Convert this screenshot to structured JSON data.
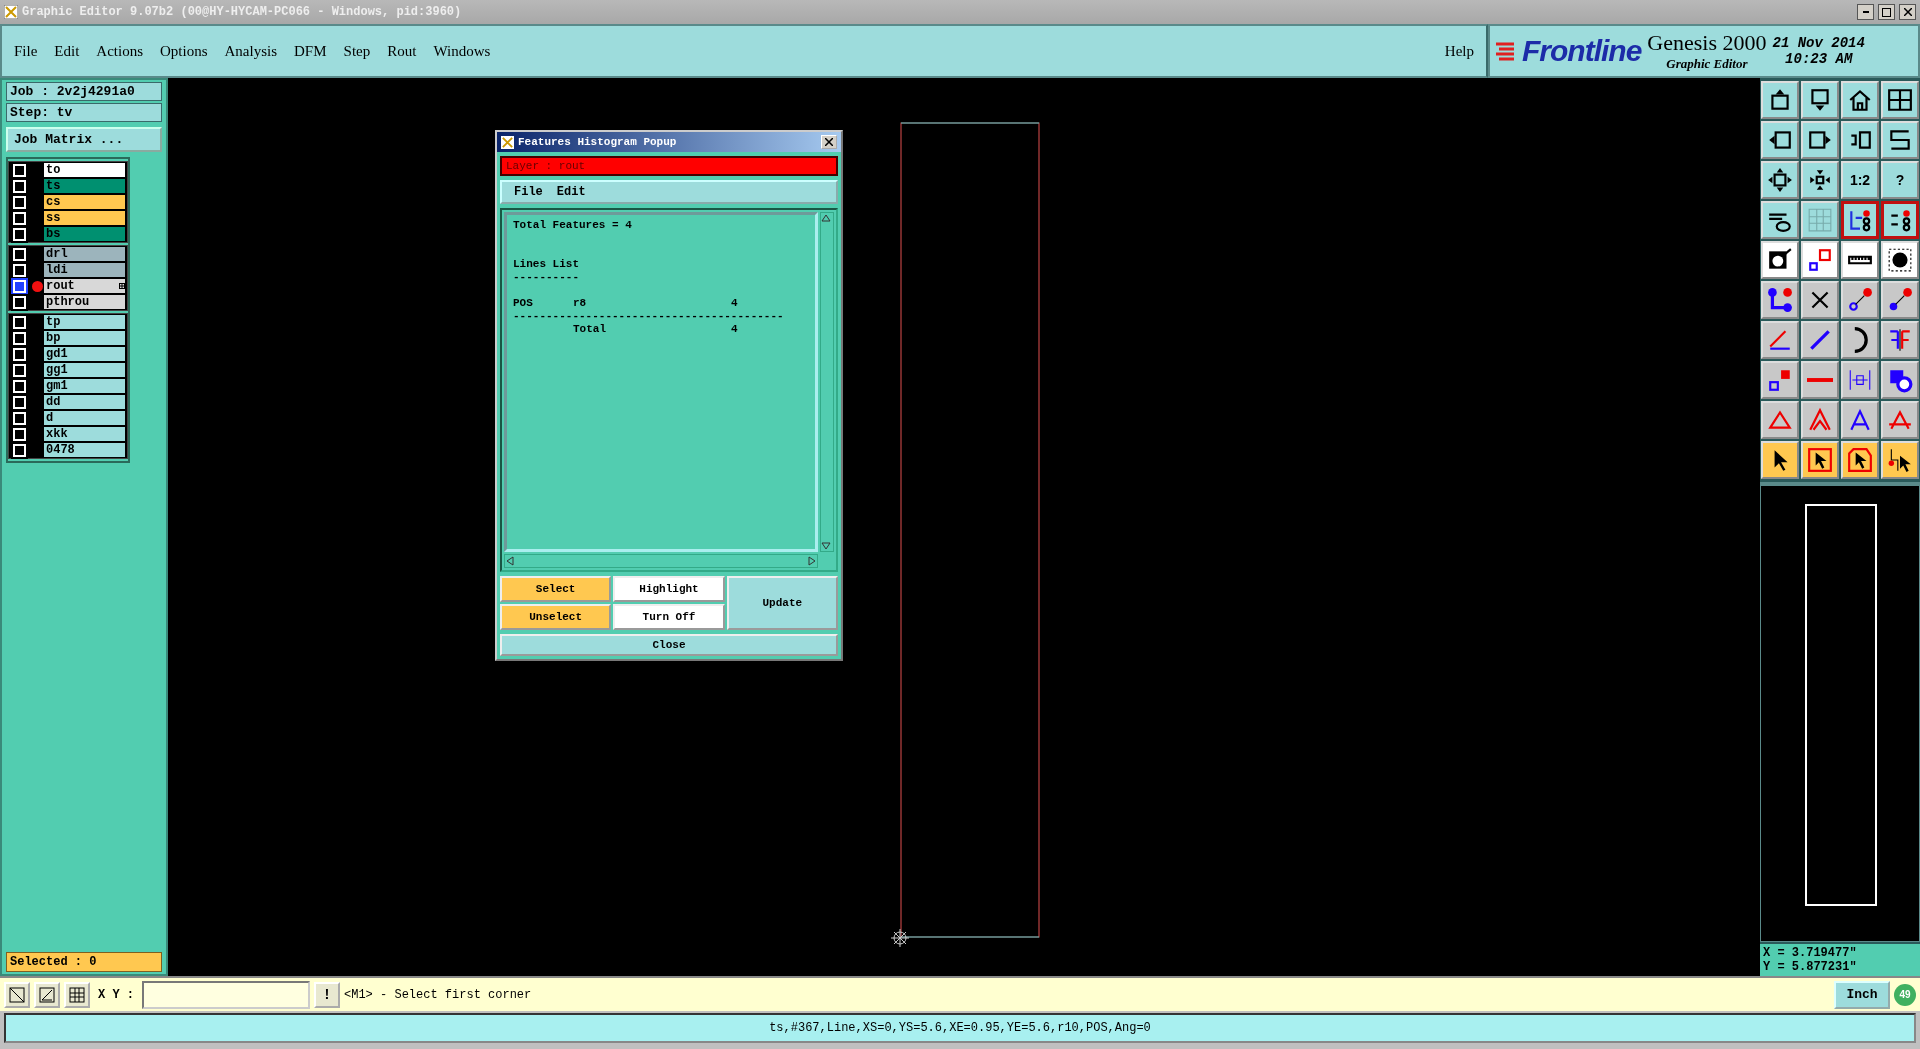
{
  "window": {
    "title": "Graphic Editor 9.07b2 (00@HY-HYCAM-PC066 - Windows, pid:3960)"
  },
  "menu": [
    "File",
    "Edit",
    "Actions",
    "Options",
    "Analysis",
    "DFM",
    "Step",
    "Rout",
    "Windows"
  ],
  "help": "Help",
  "brand": {
    "logo": "Frontline",
    "product": "Genesis 2000",
    "subtitle": "Graphic Editor",
    "date": "21 Nov 2014",
    "time": "10:23 AM"
  },
  "job": {
    "job": "Job : 2v2j4291a0",
    "step": "Step: tv",
    "matrix_button": "Job Matrix ..."
  },
  "layer_groups": [
    [
      {
        "name": "to",
        "color": "#ffffff",
        "selected": false
      },
      {
        "name": "ts",
        "color": "#009070",
        "selected": false
      },
      {
        "name": "cs",
        "color": "#ffc850",
        "selected": false
      },
      {
        "name": "ss",
        "color": "#ffc850",
        "selected": false
      },
      {
        "name": "bs",
        "color": "#009070",
        "selected": false
      }
    ],
    [
      {
        "name": "drl",
        "color": "#9cb4bc",
        "selected": false
      },
      {
        "name": "ldi",
        "color": "#9cb4bc",
        "selected": false
      },
      {
        "name": "rout",
        "color": "#d8d8d8",
        "selected": true
      },
      {
        "name": "pthrou",
        "color": "#d8d8d8",
        "selected": false
      }
    ],
    [
      {
        "name": "tp",
        "color": "#9ddcdc",
        "selected": false
      },
      {
        "name": "bp",
        "color": "#9ddcdc",
        "selected": false
      },
      {
        "name": "gd1",
        "color": "#9ddcdc",
        "selected": false
      },
      {
        "name": "gg1",
        "color": "#9ddcdc",
        "selected": false
      },
      {
        "name": "gm1",
        "color": "#9ddcdc",
        "selected": false
      },
      {
        "name": "dd",
        "color": "#9ddcdc",
        "selected": false
      },
      {
        "name": "d",
        "color": "#9ddcdc",
        "selected": false
      },
      {
        "name": "xkk",
        "color": "#9ddcdc",
        "selected": false
      },
      {
        "name": "0478",
        "color": "#9ddcdc",
        "selected": false
      }
    ]
  ],
  "selected_count": "Selected : 0",
  "popup": {
    "title": "Features Histogram Popup",
    "layer": "Layer :  rout",
    "menu": [
      "File",
      "Edit"
    ],
    "total": "Total Features = 4",
    "section": "Lines List",
    "underline": "----------",
    "rows": [
      {
        "polarity": "POS",
        "symbol": "r8",
        "count": "4"
      }
    ],
    "separator": "-----------------------------------------",
    "sum": {
      "label": "Total",
      "count": "4"
    },
    "buttons": [
      {
        "label": "Select",
        "kind": "orange"
      },
      {
        "label": "Highlight",
        "kind": "white"
      },
      {
        "label": "Update",
        "kind": "cyan"
      },
      {
        "label": "Unselect",
        "kind": "orange"
      },
      {
        "label": "Turn Off",
        "kind": "white"
      }
    ],
    "close": "Close"
  },
  "toolbar": [
    {
      "kind": "cyan"
    },
    {
      "kind": "cyan"
    },
    {
      "kind": "cyan"
    },
    {
      "kind": "cyan"
    },
    {
      "kind": "cyan"
    },
    {
      "kind": "cyan"
    },
    {
      "kind": "cyan"
    },
    {
      "kind": "cyan"
    },
    {
      "kind": "cyan"
    },
    {
      "kind": "cyan"
    },
    {
      "kind": "cyan",
      "label": "1:2"
    },
    {
      "kind": "cyan",
      "label": "?"
    },
    {
      "kind": "cyan"
    },
    {
      "kind": "cyan"
    },
    {
      "kind": "framed"
    },
    {
      "kind": "framed"
    },
    {
      "kind": "white"
    },
    {
      "kind": "white"
    },
    {
      "kind": "white"
    },
    {
      "kind": "white"
    },
    {
      "kind": "grey"
    },
    {
      "kind": "grey"
    },
    {
      "kind": "grey"
    },
    {
      "kind": "grey"
    },
    {
      "kind": "grey"
    },
    {
      "kind": "grey"
    },
    {
      "kind": "grey"
    },
    {
      "kind": "grey"
    },
    {
      "kind": "grey"
    },
    {
      "kind": "grey"
    },
    {
      "kind": "grey"
    },
    {
      "kind": "grey"
    },
    {
      "kind": "grey"
    },
    {
      "kind": "grey"
    },
    {
      "kind": "grey"
    },
    {
      "kind": "grey"
    },
    {
      "kind": "orange"
    },
    {
      "kind": "orange"
    },
    {
      "kind": "orange"
    },
    {
      "kind": "orange"
    }
  ],
  "coords": {
    "x": "X = 3.719477\"",
    "y": "Y = 5.877231\""
  },
  "command": {
    "xy_label": "X Y :",
    "alert": "!",
    "prompt": "<M1> - Select first corner",
    "units": "Inch",
    "badge": "49"
  },
  "status_bar": "ts,#367,Line,XS=0,YS=5.6,XE=0.95,YE=5.6,r10,POS,Ang=0"
}
